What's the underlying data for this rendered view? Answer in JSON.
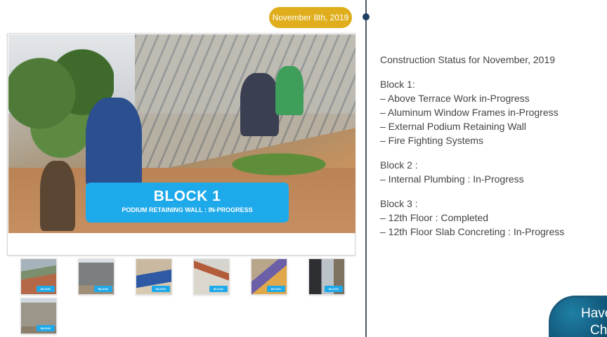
{
  "timeline": {
    "date": "November 8th, 2019"
  },
  "main_image": {
    "caption_title": "BLOCK 1",
    "caption_subtitle": "PODIUM RETAINING WALL  : IN-PROGRESS"
  },
  "thumbnails": [
    {
      "tag": "BLOCK"
    },
    {
      "tag": "BLOCK"
    },
    {
      "tag": "BLOCK"
    },
    {
      "tag": "BLOCK"
    },
    {
      "tag": "BLOCK"
    },
    {
      "tag": "BLOCK"
    },
    {
      "tag": "BLOCK"
    }
  ],
  "status": {
    "heading": "Construction Status for November, 2019",
    "blocks": [
      {
        "title": "Block 1",
        "suffix": ":",
        "items": [
          "– Above Terrace Work in-Progress",
          "– Aluminum Window Frames in-Progress",
          "– External Podium Retaining Wall",
          "– Fire Fighting Systems"
        ]
      },
      {
        "title": "Block 2",
        "suffix": " :",
        "items": [
          "– Internal Plumbing : In-Progress"
        ]
      },
      {
        "title": "Block 3",
        "suffix": " :",
        "items": [
          "– 12th Floor : Completed",
          "– 12th Floor Slab Concreting : In-Progress"
        ]
      }
    ]
  },
  "chat": {
    "line1": "Have",
    "line2": "Cha"
  },
  "colors": {
    "date_badge": "#e0ae1c",
    "caption_box": "#1ea9ea",
    "timeline": "#4b5563",
    "chat_widget": "#0d4c6d"
  }
}
